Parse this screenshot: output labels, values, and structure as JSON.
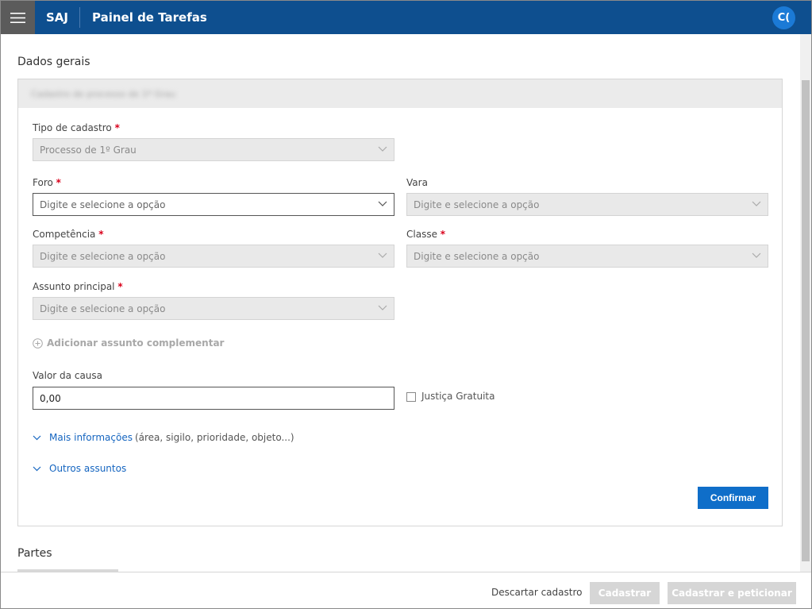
{
  "header": {
    "brand": "SAJ",
    "title": "Painel de Tarefas",
    "avatar_initials": "C("
  },
  "dados_gerais": {
    "title": "Dados gerais",
    "blurred_header": "Cadastro de processo de 1º Grau",
    "fields": {
      "tipo_cadastro": {
        "label": "Tipo de cadastro",
        "required_mark": "*",
        "value": "Processo de 1º Grau"
      },
      "foro": {
        "label": "Foro",
        "required_mark": "*",
        "placeholder": "Digite e selecione a opção"
      },
      "vara": {
        "label": "Vara",
        "placeholder": "Digite e selecione a opção"
      },
      "competencia": {
        "label": "Competência",
        "required_mark": "*",
        "placeholder": "Digite e selecione a opção"
      },
      "classe": {
        "label": "Classe",
        "required_mark": "*",
        "placeholder": "Digite e selecione a opção"
      },
      "assunto_principal": {
        "label": "Assunto principal",
        "required_mark": "*",
        "placeholder": "Digite e selecione a opção"
      },
      "valor_causa": {
        "label": "Valor da causa",
        "value": "0,00"
      }
    },
    "add_assunto_label": "Adicionar assunto complementar",
    "justica_gratuita_label": "Justiça Gratuita",
    "mais_info": {
      "link": "Mais informações",
      "desc": "(área, sigilo, prioridade, objeto...)"
    },
    "outros_assuntos": "Outros assuntos",
    "confirm_label": "Confirmar"
  },
  "partes": {
    "title": "Partes"
  },
  "footer": {
    "descartar": "Descartar cadastro",
    "cadastrar": "Cadastrar",
    "cadastrar_peticionar": "Cadastrar e peticionar"
  },
  "colors": {
    "header_bg": "#0e4f8f",
    "primary": "#0f6ec9",
    "link": "#1565c0",
    "required": "#d9001b"
  }
}
